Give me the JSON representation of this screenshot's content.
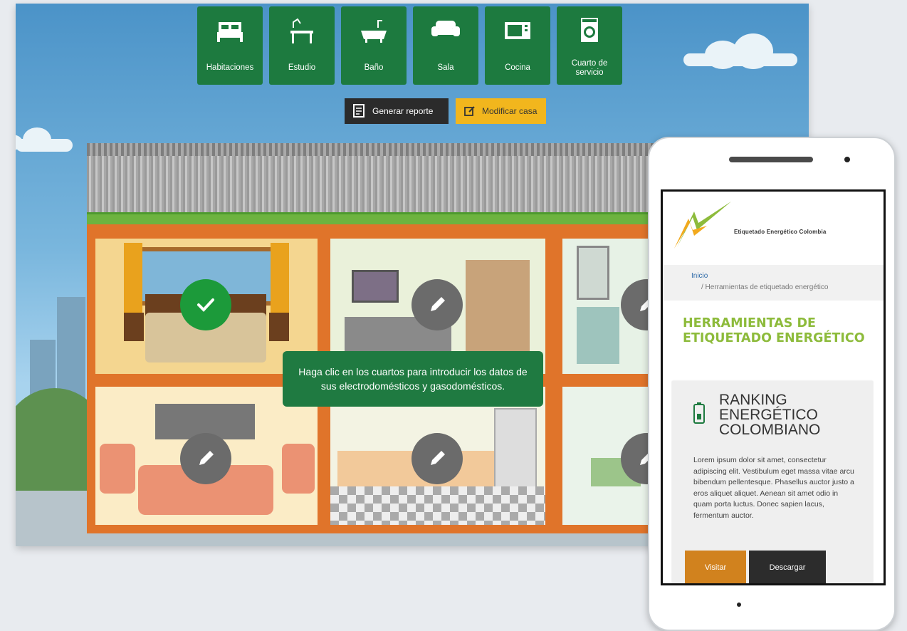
{
  "toolbar": {
    "rooms": [
      {
        "label": "Habitaciones",
        "icon": "bed-icon"
      },
      {
        "label": "Estudio",
        "icon": "desk-lamp-icon"
      },
      {
        "label": "Baño",
        "icon": "bathtub-icon"
      },
      {
        "label": "Sala",
        "icon": "sofa-icon"
      },
      {
        "label": "Cocina",
        "icon": "microwave-icon"
      },
      {
        "label_line1": "Cuarto de",
        "label_line2": "servicio",
        "icon": "washing-machine-icon"
      }
    ],
    "report_label": "Generar reporte",
    "modify_label": "Modificar casa"
  },
  "house": {
    "tooltip": "Haga clic en los cuartos para introducir los datos de sus electrodomésticos y gasodomésticos.",
    "rooms_status": [
      {
        "room": "bedroom",
        "status": "check-icon"
      },
      {
        "room": "study",
        "status": "pencil-icon"
      },
      {
        "room": "bathroom",
        "status": "pencil-icon"
      },
      {
        "room": "living",
        "status": "pencil-icon"
      },
      {
        "room": "kitchen",
        "status": "pencil-icon"
      },
      {
        "room": "laundry",
        "status": "pencil-icon"
      }
    ]
  },
  "mobile": {
    "logo_text": "Etiquetado Energético Colombia",
    "breadcrumb": {
      "home": "Inicio",
      "current": "/  Herramientas de etiquetado energético"
    },
    "page_title": "HERRAMIENTAS DE ETIQUETADO ENERGÉTICO",
    "card": {
      "title": "RANKING ENERGÉTICO COLOMBIANO",
      "text": "Lorem ipsum dolor sit amet, consectetur adipiscing elit. Vestibulum eget massa vitae arcu bibendum pellentesque. Phasellus auctor justo a eros aliquet aliquet. Aenean sit amet odio in quam porta luctus. Donec sapien lacus, fermentum auctor.",
      "visit_label": "Visitar",
      "download_label": "Descargar"
    }
  },
  "colors": {
    "primary_green": "#1d7a3f",
    "accent_yellow": "#f2b61d",
    "title_green": "#8dbb3b",
    "visit_orange": "#d1821e"
  }
}
